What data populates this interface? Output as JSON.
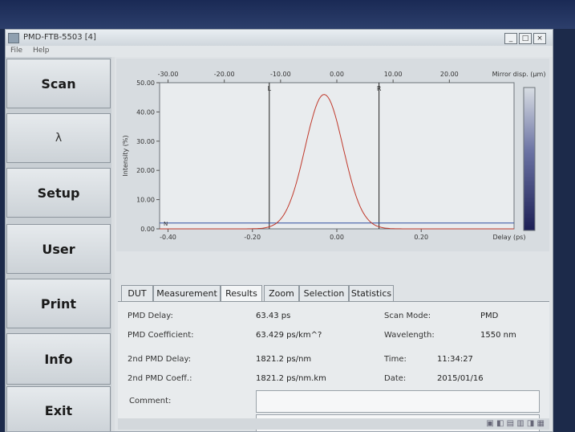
{
  "window": {
    "title": "PMD-FTB-5503 [4]",
    "min_glyph": "_",
    "max_glyph": "□",
    "close_glyph": "×"
  },
  "menu": {
    "file": "File",
    "help": "Help"
  },
  "sidebar": {
    "scan": "Scan",
    "lambda": "λ",
    "setup": "Setup",
    "user": "User",
    "print": "Print",
    "info": "Info",
    "exit": "Exit"
  },
  "chart_data": {
    "type": "line",
    "top_axis": {
      "ticks": [
        "-30.00",
        "-20.00",
        "-10.00",
        "0.00",
        "10.00",
        "20.00"
      ],
      "values": [
        -30,
        -20,
        -10,
        0,
        10,
        20
      ],
      "label": "Mirror disp. (μm)"
    },
    "bottom_axis": {
      "ticks": [
        "-0.40",
        "-0.20",
        "0.00",
        "0.20"
      ],
      "values": [
        -0.4,
        -0.2,
        0.0,
        0.2
      ],
      "label": "Delay (ps)",
      "range": [
        -0.42,
        0.42
      ]
    },
    "y_axis": {
      "ticks": [
        "50.00",
        "40.00",
        "30.00",
        "20.00",
        "10.00",
        "0.00"
      ],
      "values": [
        50,
        40,
        30,
        20,
        10,
        0
      ],
      "label": "Intensity (%)",
      "range": [
        0,
        50
      ]
    },
    "markers": [
      {
        "label": "L",
        "x": -0.16
      },
      {
        "label": "R",
        "x": 0.1
      }
    ],
    "corner_label": "N",
    "series": [
      {
        "color": "#c0392b",
        "peak_x": -0.03,
        "peak_y": 46,
        "sigma": 0.045
      },
      {
        "color": "#2f4f9f",
        "flat_y": 2.0
      }
    ]
  },
  "tabs": [
    "DUT",
    "Measurement",
    "Results",
    "Zoom",
    "Selection",
    "Statistics"
  ],
  "results": {
    "pmd_delay_label": "PMD Delay:",
    "pmd_delay_value": "63.43  ps",
    "pmd_coef_label": "PMD Coefficient:",
    "pmd_coef_value": "63.429 ps/km^?",
    "pmd2_delay_label": "2nd PMD Delay:",
    "pmd2_delay_value": "1821.2 ps/nm",
    "pmd2_coef_label": "2nd PMD Coeff.:",
    "pmd2_coef_value": "1821.2 ps/nm.km",
    "scan_mode_label": "Scan Mode:",
    "scan_mode_value": "PMD",
    "wavelength_label": "Wavelength:",
    "wavelength_value": "1550 nm",
    "time_label": "Time:",
    "time_value": "11:34:27",
    "date_label": "Date:",
    "date_value": "2015/01/16",
    "comment_label": "Comment:"
  }
}
